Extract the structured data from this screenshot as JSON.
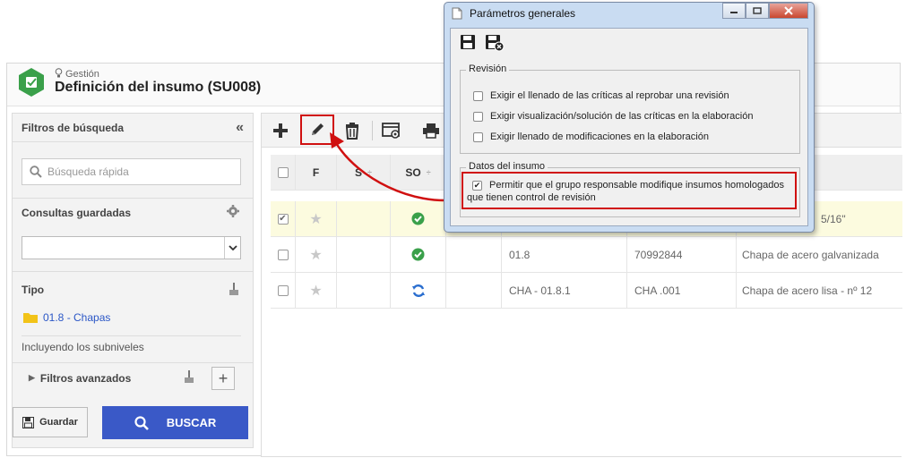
{
  "app": {
    "subtitle": "Gestión",
    "title": "Definición del insumo (SU008)"
  },
  "left_panel": {
    "title": "Filtros de búsqueda",
    "collapse_icon": "double-chevron-left",
    "search_placeholder": "Búsqueda rápida",
    "saved_queries_label": "Consultas guardadas",
    "tipo_label": "Tipo",
    "tipo_item": "01.8 - Chapas",
    "include_sublevels": "Incluyendo los subniveles",
    "advanced_filters": "Filtros avanzados",
    "save_button": "Guardar",
    "search_button": "BUSCAR"
  },
  "toolbar": {
    "icons": [
      "plus-icon",
      "pencil-icon",
      "trash-icon",
      "view-icon",
      "print-icon"
    ]
  },
  "grid": {
    "headers": [
      "F",
      "S",
      "SO"
    ],
    "rows": [
      {
        "selected": true,
        "status": "check",
        "col1": "",
        "col2": "",
        "col3": "5/16\""
      },
      {
        "selected": false,
        "status": "check",
        "col1": "01.8",
        "col2": "70992844",
        "col3": "Chapa de acero galvanizada"
      },
      {
        "selected": false,
        "status": "revision",
        "col1": "CHA - 01.8.1",
        "col2": "CHA .001",
        "col3": "Chapa de acero lisa - nº 12"
      }
    ]
  },
  "dialog": {
    "title": "Parámetros generales",
    "revision_legend": "Revisión",
    "revision_options": [
      {
        "label": "Exigir el llenado de las críticas al reprobar una revisión",
        "checked": false
      },
      {
        "label": "Exigir visualización/solución de las críticas en la elaboración",
        "checked": false
      },
      {
        "label": "Exigir llenado de modificaciones en la elaboración",
        "checked": false
      }
    ],
    "data_legend": "Datos del insumo",
    "data_option_line1": "Permitir que el grupo responsable modifique insumos homologados",
    "data_option_line2": "que tienen control de revisión",
    "data_option_checked": true
  },
  "colors": {
    "accent_blue": "#3a59c7",
    "highlight_red": "#d01010",
    "status_green": "#3aa04a",
    "selected_row": "#fcfbdf"
  }
}
